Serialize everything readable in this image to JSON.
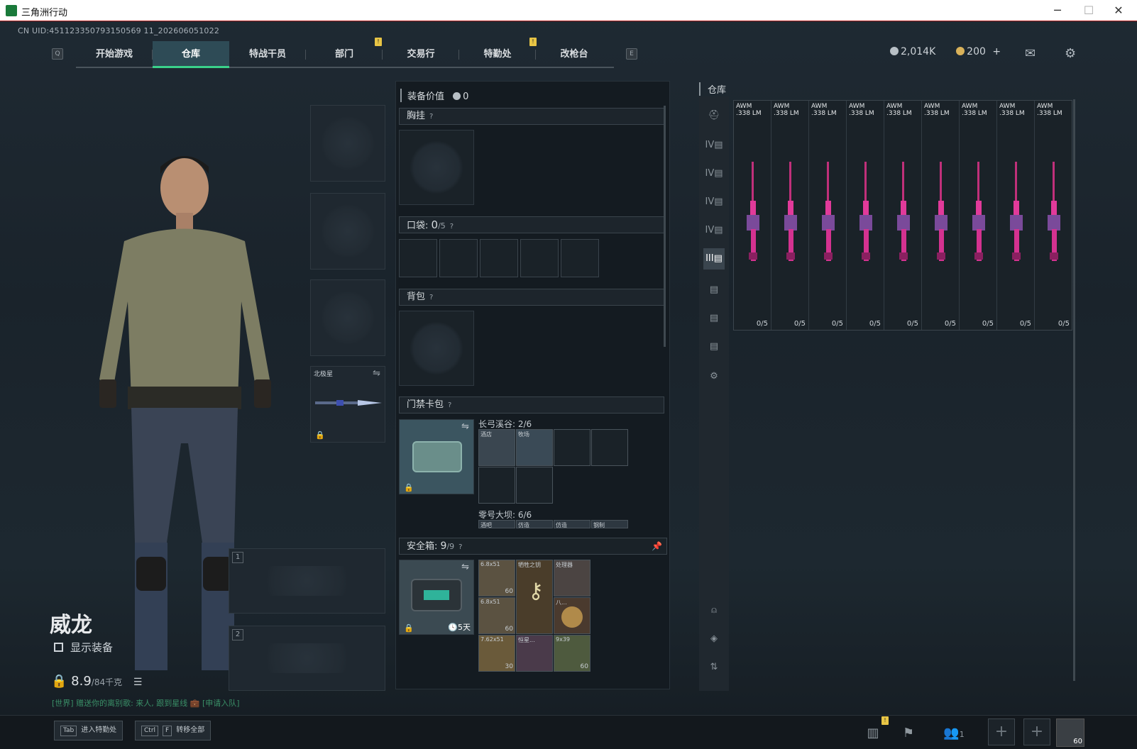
{
  "window": {
    "title": "三角洲行动",
    "minimize": "─",
    "maximize": "☐",
    "close": "✕"
  },
  "uid": "CN UID:451123350793150569 11_202606051022",
  "nav": {
    "key_left": "Q",
    "key_right": "E",
    "tabs": [
      {
        "label": "开始游戏"
      },
      {
        "label": "仓库"
      },
      {
        "label": "特战干员"
      },
      {
        "label": "部门"
      },
      {
        "label": "交易行"
      },
      {
        "label": "特勤处"
      },
      {
        "label": "改枪台"
      }
    ],
    "badge": "!"
  },
  "currency": {
    "silver": "2,014K",
    "gold": "200",
    "plus": "+",
    "silver_color": "#b8c0c6",
    "gold_color": "#d9b25a"
  },
  "character": {
    "name": "威龙",
    "show_equipment": "显示装备",
    "weight_value": "8.9",
    "weight_cap": "/84千克"
  },
  "chat": {
    "line": "[世界] 赠送你的离别歌: 来人, 跟到星线 💼 [申请入队]"
  },
  "loadout": {
    "knife_label": "北极星",
    "weapon_slot_1": "1",
    "weapon_slot_2": "2"
  },
  "equipment_panel": {
    "value_label": "装备价值",
    "value": "0",
    "chest_rig": "胸挂",
    "pockets_label": "口袋:",
    "pockets_count": "0",
    "pockets_cap": "/5",
    "backpack": "背包",
    "keycard_case": "门禁卡包",
    "help": "?",
    "keycard_group1": {
      "title": "长弓溪谷: 2/6",
      "cards": [
        "酒店",
        "牧场"
      ]
    },
    "keycard_group2": {
      "title": "零号大坝: 6/6",
      "cards": [
        "酒吧",
        "仿造",
        "仿造",
        "钢制"
      ]
    },
    "safebox_label": "安全箱:",
    "safebox_count": "9",
    "safebox_cap": "/9",
    "safebox_timer": "5天",
    "safebox_items": [
      {
        "name": "6.8x51",
        "qty": "60"
      },
      {
        "name": "牺牲之钥",
        "qty": ""
      },
      {
        "name": "处理器",
        "qty": ""
      },
      {
        "name": "6.8x51",
        "qty": "60"
      },
      {
        "name": "",
        "qty": ""
      },
      {
        "name": "八...",
        "qty": ""
      },
      {
        "name": "7.62x51",
        "qty": "30"
      },
      {
        "name": "恒星...",
        "qty": ""
      },
      {
        "name": "9x39",
        "qty": "60"
      }
    ]
  },
  "warehouse": {
    "title": "仓库",
    "guns": [
      {
        "name": "AWM",
        "caliber": ".338 LM",
        "count": "0/5"
      },
      {
        "name": "AWM",
        "caliber": ".338 LM",
        "count": "0/5"
      },
      {
        "name": "AWM",
        "caliber": ".338 LM",
        "count": "0/5"
      },
      {
        "name": "AWM",
        "caliber": ".338 LM",
        "count": "0/5"
      },
      {
        "name": "AWM",
        "caliber": ".338 LM",
        "count": "0/5"
      },
      {
        "name": "AWM",
        "caliber": ".338 LM",
        "count": "0/5"
      },
      {
        "name": "AWM",
        "caliber": ".338 LM",
        "count": "0/5"
      },
      {
        "name": "AWM",
        "caliber": ".338 LM",
        "count": "0/5"
      },
      {
        "name": "AWM",
        "caliber": ".338 LM",
        "count": "0/5"
      }
    ],
    "side_tabs": [
      "helmet-icon",
      "tier-iv-icon",
      "tier-iv-icon",
      "tier-iv-icon",
      "tier-iv-icon",
      "tier-iii-icon",
      "tier-iii-icon",
      "tier-iii-icon",
      "tier-iii-icon",
      "gear-icon"
    ]
  },
  "bottom": {
    "tab_key": "Tab",
    "tab_label": "进入特勤处",
    "ctrl_key": "Ctrl",
    "f_key": "F",
    "ctrl_label": "转移全部",
    "team_count": "1",
    "avatar_level": "60"
  }
}
